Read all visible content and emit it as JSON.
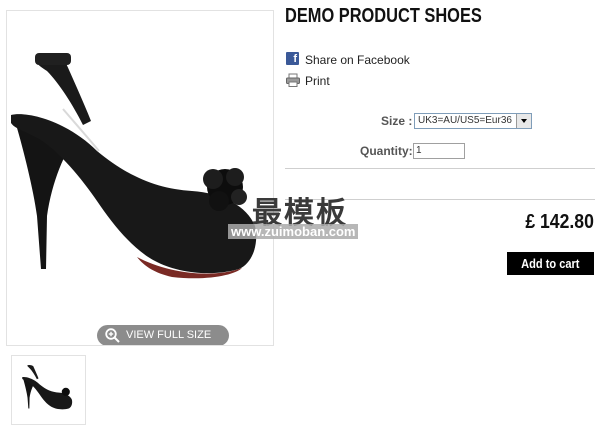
{
  "product": {
    "title": "DEMO PRODUCT SHOES",
    "price": "£ 142.80"
  },
  "image": {
    "view_full_label": "VIEW FULL SIZE"
  },
  "social": {
    "facebook_label": "Share on Facebook",
    "print_label": "Print"
  },
  "options": {
    "size_label": "Size :",
    "size_value": "UK3=AU/US5=Eur36",
    "quantity_label": "Quantity:",
    "quantity_value": "1"
  },
  "actions": {
    "add_to_cart": "Add to cart"
  },
  "watermark": {
    "text": "最模板",
    "url": "www.zuimoban.com"
  },
  "colors": {
    "facebook": "#3b5998",
    "button_bg": "#000000",
    "view_full_bg": "#8c8c8c"
  },
  "icons": [
    "facebook-icon",
    "print-icon",
    "zoom-icon",
    "dropdown-arrow-icon"
  ]
}
